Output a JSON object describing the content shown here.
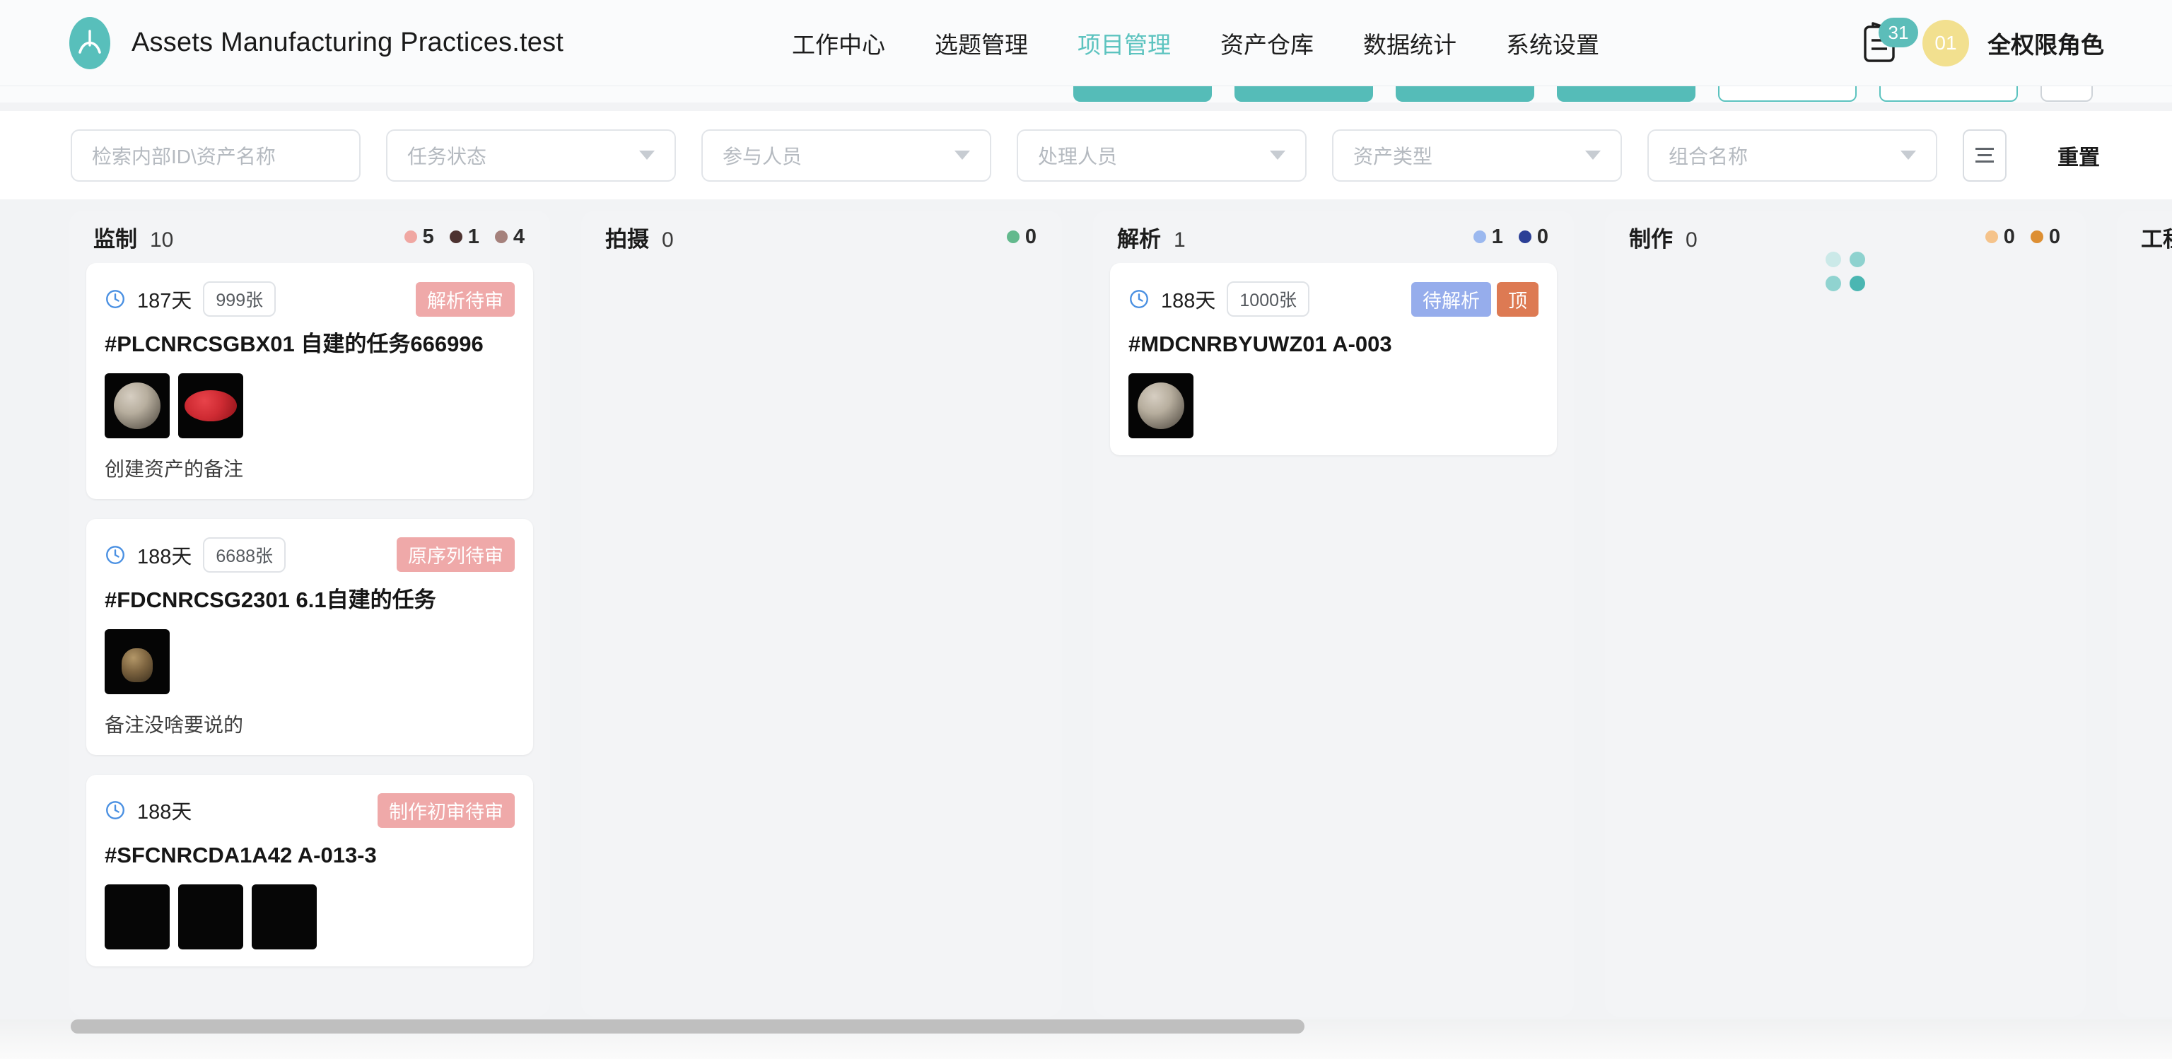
{
  "header": {
    "brand_title": "Assets Manufacturing Practices.test",
    "logo_icon": "compass-a-logo-icon",
    "nav": [
      {
        "label": "工作中心",
        "active": false
      },
      {
        "label": "选题管理",
        "active": false
      },
      {
        "label": "项目管理",
        "active": true
      },
      {
        "label": "资产仓库",
        "active": false
      },
      {
        "label": "数据统计",
        "active": false
      },
      {
        "label": "系统设置",
        "active": false
      }
    ],
    "notification": {
      "icon": "clipboard-icon",
      "badge": "31"
    },
    "user": {
      "avatar_initials": "01",
      "name": "全权限角色"
    }
  },
  "filters": {
    "search": {
      "placeholder": "检索内部ID\\资产名称",
      "value": ""
    },
    "selects": [
      {
        "placeholder": "任务状态",
        "value": ""
      },
      {
        "placeholder": "参与人员",
        "value": ""
      },
      {
        "placeholder": "处理人员",
        "value": ""
      },
      {
        "placeholder": "资产类型",
        "value": ""
      },
      {
        "placeholder": "组合名称",
        "value": ""
      }
    ],
    "list_view_icon": "list-view-icon",
    "reset_label": "重置"
  },
  "colors": {
    "accent": "#55bcb8",
    "nav_active": "#5cc3bf",
    "avatar": "#f2e08f",
    "tag_pink": "#efa9a9",
    "tag_blue": "#96adec",
    "tag_orange": "#dd7a53"
  },
  "board": {
    "columns": [
      {
        "name": "监制",
        "count": "10",
        "stats": [
          {
            "color": "#f0a7a2",
            "value": "5"
          },
          {
            "color": "#4d3230",
            "value": "1"
          },
          {
            "color": "#a5817c",
            "value": "4"
          }
        ],
        "cards": [
          {
            "days": "187天",
            "shots": "999张",
            "tags": [
              {
                "text": "解析待审",
                "color": "#efa9a9"
              }
            ],
            "title": "#PLCNRCSGBX01  自建的任务666996",
            "thumbs": [
              "sphere",
              "lantern"
            ],
            "note": "创建资产的备注"
          },
          {
            "days": "188天",
            "shots": "6688张",
            "tags": [
              {
                "text": "原序列待审",
                "color": "#efa9a9"
              }
            ],
            "title": "#FDCNRCSG2301  6.1自建的任务",
            "thumbs": [
              "pot"
            ],
            "note": "备注没啥要说的"
          },
          {
            "days": "188天",
            "shots": "",
            "tags": [
              {
                "text": "制作初审待审",
                "color": "#efa9a9"
              }
            ],
            "title": "#SFCNRCDA1A42  A-013-3",
            "thumbs": [
              "plain2",
              "plain2",
              "plain2"
            ],
            "note": ""
          }
        ]
      },
      {
        "name": "拍摄",
        "count": "0",
        "stats": [
          {
            "color": "#63b98d",
            "value": "0"
          }
        ],
        "cards": []
      },
      {
        "name": "解析",
        "count": "1",
        "stats": [
          {
            "color": "#9bb8ef",
            "value": "1"
          },
          {
            "color": "#2b3f96",
            "value": "0"
          }
        ],
        "cards": [
          {
            "days": "188天",
            "shots": "1000张",
            "tags": [
              {
                "text": "待解析",
                "color": "#96adec"
              },
              {
                "text": "顶",
                "color": "#dd7a53"
              }
            ],
            "title": "#MDCNRBYUWZ01  A-003",
            "thumbs": [
              "sphere"
            ],
            "note": ""
          }
        ]
      },
      {
        "name": "制作",
        "count": "0",
        "stats": [
          {
            "color": "#f5c38b",
            "value": "0"
          },
          {
            "color": "#dd8f33",
            "value": "0"
          }
        ],
        "cards": [],
        "loading": true
      },
      {
        "name": "工程文件",
        "count": "",
        "stats": [],
        "cards": []
      }
    ]
  }
}
